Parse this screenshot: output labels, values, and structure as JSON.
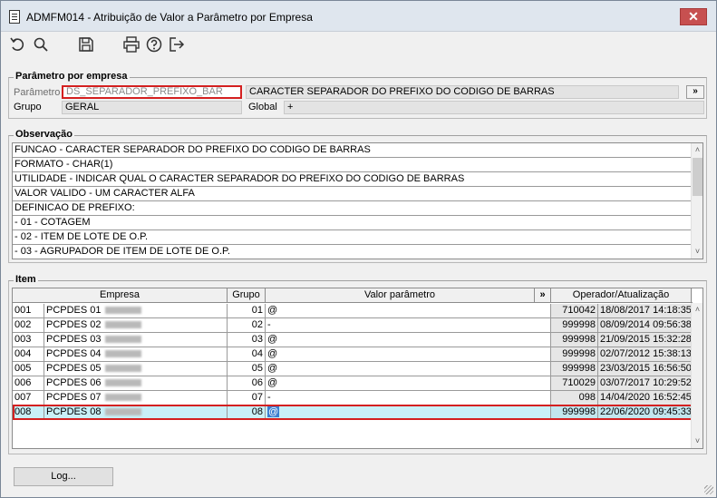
{
  "window": {
    "title": "ADMFM014 - Atribuição de Valor a Parâmetro por Empresa",
    "close_glyph": "✕"
  },
  "toolbar": [
    "undo-icon",
    "search-icon",
    "save-icon",
    "print-icon",
    "help-icon",
    "exit-icon"
  ],
  "param_section": {
    "title": "Parâmetro por empresa",
    "param_label": "Parâmetro",
    "param_value": "DS_SEPARADOR_PREFIXO_BAR",
    "param_desc": "CARACTER SEPARADOR DO PREFIXO DO CODIGO DE BARRAS",
    "expand_label": "»",
    "group_label": "Grupo",
    "group_value": "GERAL",
    "global_label": "Global",
    "global_value": "+"
  },
  "obs_section": {
    "title": "Observação",
    "lines": [
      "FUNCAO - CARACTER SEPARADOR DO PREFIXO DO CODIGO DE BARRAS",
      "FORMATO - CHAR(1)",
      "UTILIDADE - INDICAR QUAL O CARACTER SEPARADOR DO PREFIXO DO CODIGO DE BARRAS",
      "VALOR VALIDO - UM CARACTER ALFA",
      "DEFINICAO DE PREFIXO:",
      "- 01 - COTAGEM",
      "- 02 - ITEM DE LOTE DE O.P.",
      "- 03 - AGRUPADOR DE ITEM DE LOTE DE O.P."
    ],
    "scroll_up": "˄",
    "scroll_down": "˅"
  },
  "item_section": {
    "title": "Item",
    "headers": {
      "empresa": "Empresa",
      "grupo": "Grupo",
      "valor": "Valor parâmetro",
      "expand": "»",
      "operador": "Operador/Atualização"
    },
    "rows": [
      {
        "code": "001",
        "name": "PCPDES 01",
        "grupo": "01",
        "valor": "@",
        "oper": "710042",
        "date": "18/08/2017 14:18:35"
      },
      {
        "code": "002",
        "name": "PCPDES 02",
        "grupo": "02",
        "valor": "-",
        "oper": "999998",
        "date": "08/09/2014 09:56:38"
      },
      {
        "code": "003",
        "name": "PCPDES 03",
        "grupo": "03",
        "valor": "@",
        "oper": "999998",
        "date": "21/09/2015 15:32:28"
      },
      {
        "code": "004",
        "name": "PCPDES 04",
        "grupo": "04",
        "valor": "@",
        "oper": "999998",
        "date": "02/07/2012 15:38:13"
      },
      {
        "code": "005",
        "name": "PCPDES 05",
        "grupo": "05",
        "valor": "@",
        "oper": "999998",
        "date": "23/03/2015 16:56:50"
      },
      {
        "code": "006",
        "name": "PCPDES 06",
        "grupo": "06",
        "valor": "@",
        "oper": "710029",
        "date": "03/07/2017 10:29:52"
      },
      {
        "code": "007",
        "name": "PCPDES 07",
        "grupo": "07",
        "valor": "-",
        "oper": "098",
        "date": "14/04/2020 16:52:45"
      },
      {
        "code": "008",
        "name": "PCPDES 08",
        "grupo": "08",
        "valor": "@",
        "oper": "999998",
        "date": "22/06/2020 09:45:33"
      }
    ],
    "selected_row": 7,
    "scroll_up": "˄",
    "scroll_down": "˅"
  },
  "footer": {
    "log_label": "Log..."
  }
}
